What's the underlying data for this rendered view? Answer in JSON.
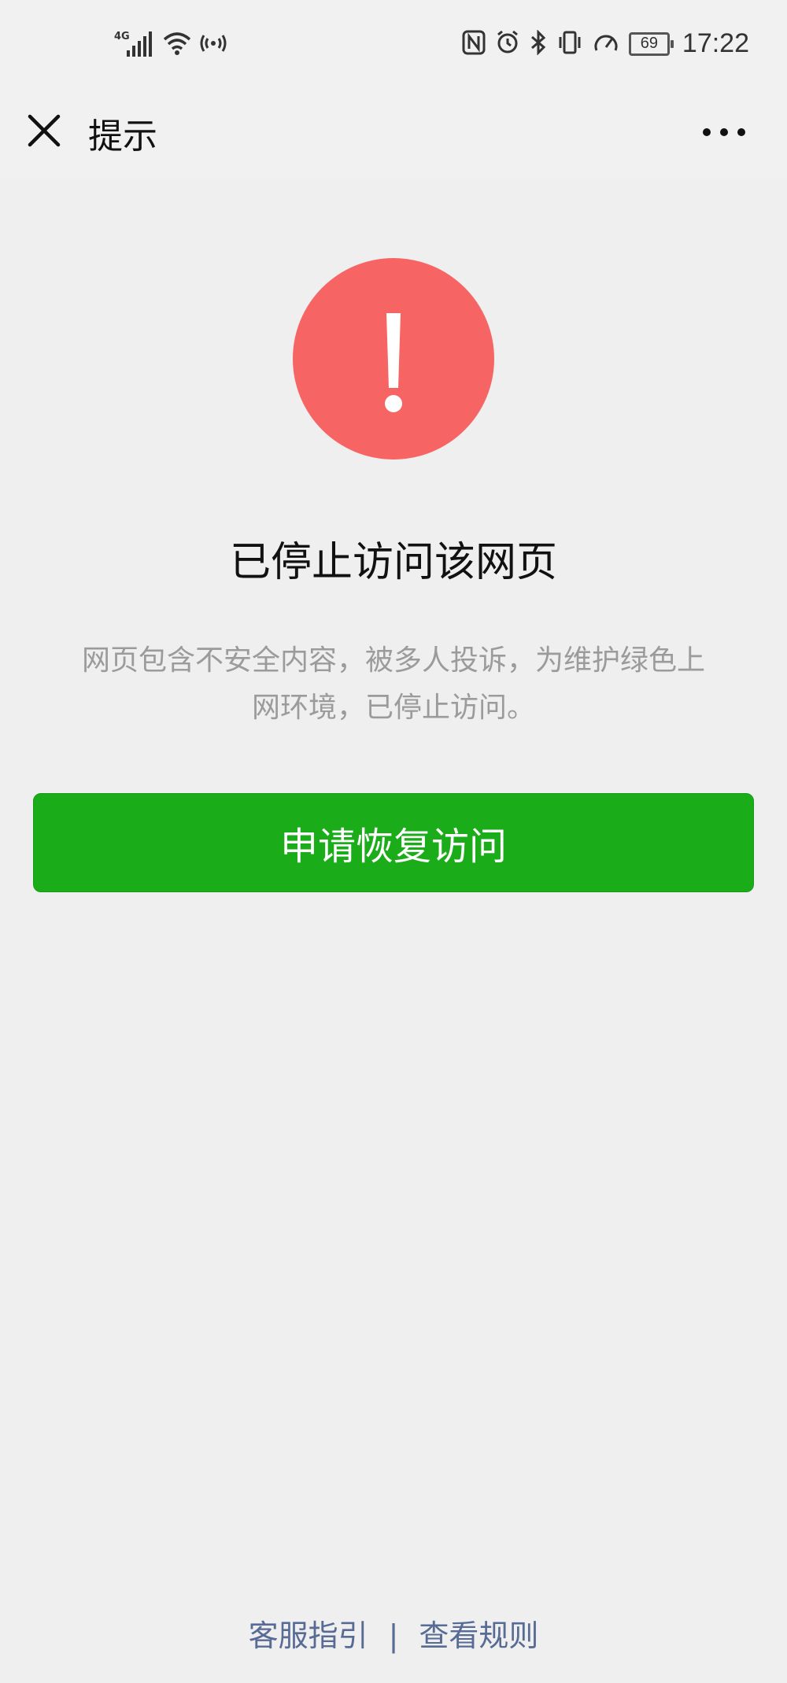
{
  "status_bar": {
    "network": "4G",
    "battery": "69",
    "time": "17:22",
    "icons": [
      "signal-icon",
      "wifi-icon",
      "hotspot-icon",
      "nfc-icon",
      "alarm-icon",
      "bluetooth-icon",
      "vibrate-icon",
      "speed-icon",
      "battery-icon"
    ]
  },
  "nav": {
    "title": "提示",
    "close_icon": "close-icon",
    "more_icon": "more-icon"
  },
  "content": {
    "icon": "warning-icon",
    "icon_color": "#f66564",
    "headline": "已停止访问该网页",
    "description_line1": "网页包含不安全内容，被多人投诉，为维护绿色上",
    "description_line2": "网环境，已停止访问。",
    "button_label": "申请恢复访问",
    "button_color": "#1aad19"
  },
  "footer": {
    "link1": "客服指引",
    "separator": "|",
    "link2": "查看规则",
    "link_color": "#576b95"
  }
}
